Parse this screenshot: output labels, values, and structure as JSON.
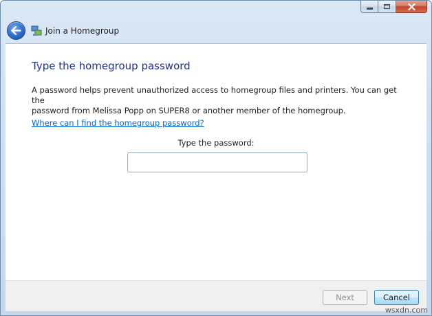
{
  "window": {
    "title": "Join a Homegroup",
    "icon": "homegroup-icon"
  },
  "caption_buttons": {
    "minimize_icon": "minimize-icon",
    "maximize_icon": "maximize-icon",
    "close_icon": "close-icon"
  },
  "nav": {
    "back_icon": "back-arrow-icon"
  },
  "main": {
    "heading": "Type the homegroup password",
    "description_line1": "A password helps prevent unauthorized access to homegroup files and printers. You can get the",
    "description_line2": "password from Melissa Popp on SUPER8 or another member of the homegroup.",
    "help_link": "Where can I find the homegroup password?",
    "password_label": "Type the password:",
    "password_value": ""
  },
  "footer": {
    "next_label": "Next",
    "cancel_label": "Cancel"
  },
  "watermark": "wsxdn.com",
  "colors": {
    "heading": "#1e3287",
    "link": "#0066cc",
    "close_button": "#c2442b"
  }
}
